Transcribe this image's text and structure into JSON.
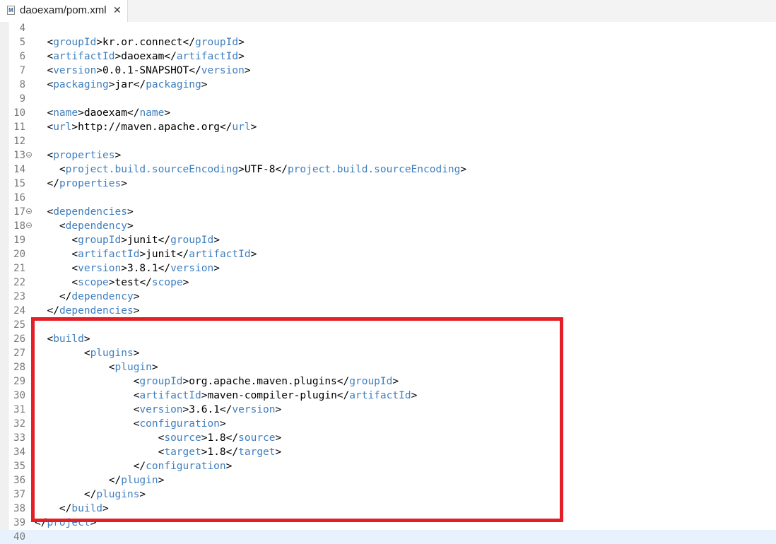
{
  "tab": {
    "icon": "M",
    "title": "daoexam/pom.xml",
    "close": "✕"
  },
  "editor": {
    "lines": [
      {
        "num": "4",
        "indent": "",
        "tokens": []
      },
      {
        "num": "5",
        "indent": "  ",
        "tokens": [
          [
            "p",
            "<"
          ],
          [
            "t",
            "groupId"
          ],
          [
            "p",
            ">"
          ],
          [
            "x",
            "kr.or.connect"
          ],
          [
            "p",
            "</"
          ],
          [
            "t",
            "groupId"
          ],
          [
            "p",
            ">"
          ]
        ]
      },
      {
        "num": "6",
        "indent": "  ",
        "tokens": [
          [
            "p",
            "<"
          ],
          [
            "t",
            "artifactId"
          ],
          [
            "p",
            ">"
          ],
          [
            "x",
            "daoexam"
          ],
          [
            "p",
            "</"
          ],
          [
            "t",
            "artifactId"
          ],
          [
            "p",
            ">"
          ]
        ]
      },
      {
        "num": "7",
        "indent": "  ",
        "tokens": [
          [
            "p",
            "<"
          ],
          [
            "t",
            "version"
          ],
          [
            "p",
            ">"
          ],
          [
            "x",
            "0.0.1-SNAPSHOT"
          ],
          [
            "p",
            "</"
          ],
          [
            "t",
            "version"
          ],
          [
            "p",
            ">"
          ]
        ]
      },
      {
        "num": "8",
        "indent": "  ",
        "tokens": [
          [
            "p",
            "<"
          ],
          [
            "t",
            "packaging"
          ],
          [
            "p",
            ">"
          ],
          [
            "x",
            "jar"
          ],
          [
            "p",
            "</"
          ],
          [
            "t",
            "packaging"
          ],
          [
            "p",
            ">"
          ]
        ]
      },
      {
        "num": "9",
        "indent": "",
        "tokens": []
      },
      {
        "num": "10",
        "indent": "  ",
        "tokens": [
          [
            "p",
            "<"
          ],
          [
            "t",
            "name"
          ],
          [
            "p",
            ">"
          ],
          [
            "x",
            "daoexam"
          ],
          [
            "p",
            "</"
          ],
          [
            "t",
            "name"
          ],
          [
            "p",
            ">"
          ]
        ]
      },
      {
        "num": "11",
        "indent": "  ",
        "tokens": [
          [
            "p",
            "<"
          ],
          [
            "t",
            "url"
          ],
          [
            "p",
            ">"
          ],
          [
            "x",
            "http://maven.apache.org"
          ],
          [
            "p",
            "</"
          ],
          [
            "t",
            "url"
          ],
          [
            "p",
            ">"
          ]
        ]
      },
      {
        "num": "12",
        "indent": "",
        "tokens": []
      },
      {
        "num": "13",
        "fold": true,
        "indent": "  ",
        "tokens": [
          [
            "p",
            "<"
          ],
          [
            "t",
            "properties"
          ],
          [
            "p",
            ">"
          ]
        ]
      },
      {
        "num": "14",
        "indent": "    ",
        "tokens": [
          [
            "p",
            "<"
          ],
          [
            "t",
            "project.build.sourceEncoding"
          ],
          [
            "p",
            ">"
          ],
          [
            "x",
            "UTF-8"
          ],
          [
            "p",
            "</"
          ],
          [
            "t",
            "project.build.sourceEncoding"
          ],
          [
            "p",
            ">"
          ]
        ]
      },
      {
        "num": "15",
        "indent": "  ",
        "tokens": [
          [
            "p",
            "</"
          ],
          [
            "t",
            "properties"
          ],
          [
            "p",
            ">"
          ]
        ]
      },
      {
        "num": "16",
        "indent": "",
        "tokens": []
      },
      {
        "num": "17",
        "fold": true,
        "indent": "  ",
        "tokens": [
          [
            "p",
            "<"
          ],
          [
            "t",
            "dependencies"
          ],
          [
            "p",
            ">"
          ]
        ]
      },
      {
        "num": "18",
        "fold": true,
        "indent": "    ",
        "tokens": [
          [
            "p",
            "<"
          ],
          [
            "t",
            "dependency"
          ],
          [
            "p",
            ">"
          ]
        ]
      },
      {
        "num": "19",
        "indent": "      ",
        "tokens": [
          [
            "p",
            "<"
          ],
          [
            "t",
            "groupId"
          ],
          [
            "p",
            ">"
          ],
          [
            "x",
            "junit"
          ],
          [
            "p",
            "</"
          ],
          [
            "t",
            "groupId"
          ],
          [
            "p",
            ">"
          ]
        ]
      },
      {
        "num": "20",
        "indent": "      ",
        "tokens": [
          [
            "p",
            "<"
          ],
          [
            "t",
            "artifactId"
          ],
          [
            "p",
            ">"
          ],
          [
            "x",
            "junit"
          ],
          [
            "p",
            "</"
          ],
          [
            "t",
            "artifactId"
          ],
          [
            "p",
            ">"
          ]
        ]
      },
      {
        "num": "21",
        "indent": "      ",
        "tokens": [
          [
            "p",
            "<"
          ],
          [
            "t",
            "version"
          ],
          [
            "p",
            ">"
          ],
          [
            "x",
            "3.8.1"
          ],
          [
            "p",
            "</"
          ],
          [
            "t",
            "version"
          ],
          [
            "p",
            ">"
          ]
        ]
      },
      {
        "num": "22",
        "indent": "      ",
        "tokens": [
          [
            "p",
            "<"
          ],
          [
            "t",
            "scope"
          ],
          [
            "p",
            ">"
          ],
          [
            "x",
            "test"
          ],
          [
            "p",
            "</"
          ],
          [
            "t",
            "scope"
          ],
          [
            "p",
            ">"
          ]
        ]
      },
      {
        "num": "23",
        "indent": "    ",
        "tokens": [
          [
            "p",
            "</"
          ],
          [
            "t",
            "dependency"
          ],
          [
            "p",
            ">"
          ]
        ]
      },
      {
        "num": "24",
        "indent": "  ",
        "tokens": [
          [
            "p",
            "</"
          ],
          [
            "t",
            "dependencies"
          ],
          [
            "p",
            ">"
          ]
        ]
      },
      {
        "num": "25",
        "indent": "",
        "tokens": []
      },
      {
        "num": "26",
        "indent": "  ",
        "tokens": [
          [
            "p",
            "<"
          ],
          [
            "t",
            "build"
          ],
          [
            "p",
            ">"
          ]
        ]
      },
      {
        "num": "27",
        "indent": "        ",
        "tokens": [
          [
            "p",
            "<"
          ],
          [
            "t",
            "plugins"
          ],
          [
            "p",
            ">"
          ]
        ]
      },
      {
        "num": "28",
        "indent": "            ",
        "tokens": [
          [
            "p",
            "<"
          ],
          [
            "t",
            "plugin"
          ],
          [
            "p",
            ">"
          ]
        ]
      },
      {
        "num": "29",
        "indent": "                ",
        "tokens": [
          [
            "p",
            "<"
          ],
          [
            "t",
            "groupId"
          ],
          [
            "p",
            ">"
          ],
          [
            "x",
            "org.apache.maven.plugins"
          ],
          [
            "p",
            "</"
          ],
          [
            "t",
            "groupId"
          ],
          [
            "p",
            ">"
          ]
        ]
      },
      {
        "num": "30",
        "indent": "                ",
        "tokens": [
          [
            "p",
            "<"
          ],
          [
            "t",
            "artifactId"
          ],
          [
            "p",
            ">"
          ],
          [
            "x",
            "maven-compiler-plugin"
          ],
          [
            "p",
            "</"
          ],
          [
            "t",
            "artifactId"
          ],
          [
            "p",
            ">"
          ]
        ]
      },
      {
        "num": "31",
        "indent": "                ",
        "tokens": [
          [
            "p",
            "<"
          ],
          [
            "t",
            "version"
          ],
          [
            "p",
            ">"
          ],
          [
            "x",
            "3.6.1"
          ],
          [
            "p",
            "</"
          ],
          [
            "t",
            "version"
          ],
          [
            "p",
            ">"
          ]
        ]
      },
      {
        "num": "32",
        "indent": "                ",
        "tokens": [
          [
            "p",
            "<"
          ],
          [
            "t",
            "configuration"
          ],
          [
            "p",
            ">"
          ]
        ]
      },
      {
        "num": "33",
        "indent": "                    ",
        "tokens": [
          [
            "p",
            "<"
          ],
          [
            "t",
            "source"
          ],
          [
            "p",
            ">"
          ],
          [
            "x",
            "1.8"
          ],
          [
            "p",
            "</"
          ],
          [
            "t",
            "source"
          ],
          [
            "p",
            ">"
          ]
        ]
      },
      {
        "num": "34",
        "indent": "                    ",
        "tokens": [
          [
            "p",
            "<"
          ],
          [
            "t",
            "target"
          ],
          [
            "p",
            ">"
          ],
          [
            "x",
            "1.8"
          ],
          [
            "p",
            "</"
          ],
          [
            "t",
            "target"
          ],
          [
            "p",
            ">"
          ]
        ]
      },
      {
        "num": "35",
        "indent": "                ",
        "tokens": [
          [
            "p",
            "</"
          ],
          [
            "t",
            "configuration"
          ],
          [
            "p",
            ">"
          ]
        ]
      },
      {
        "num": "36",
        "indent": "            ",
        "tokens": [
          [
            "p",
            "</"
          ],
          [
            "t",
            "plugin"
          ],
          [
            "p",
            ">"
          ]
        ]
      },
      {
        "num": "37",
        "indent": "        ",
        "tokens": [
          [
            "p",
            "</"
          ],
          [
            "t",
            "plugins"
          ],
          [
            "p",
            ">"
          ]
        ]
      },
      {
        "num": "38",
        "indent": "    ",
        "tokens": [
          [
            "p",
            "</"
          ],
          [
            "t",
            "build"
          ],
          [
            "p",
            ">"
          ]
        ]
      },
      {
        "num": "39",
        "indent": "",
        "tokens": [
          [
            "p",
            "</"
          ],
          [
            "t",
            "project"
          ],
          [
            "p",
            ">"
          ]
        ]
      },
      {
        "num": "40",
        "current": true,
        "indent": "",
        "tokens": []
      }
    ]
  },
  "colors": {
    "tag": "#3f7fbf",
    "text": "#000000",
    "highlight": "#e41e26",
    "current_line": "#e8f2fe"
  }
}
